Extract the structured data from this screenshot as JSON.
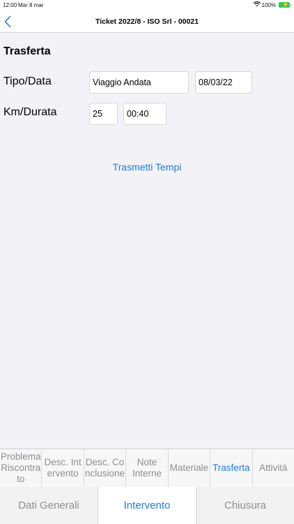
{
  "status": {
    "time": "12:00",
    "date": "Mar 8 mar",
    "battery": "100%"
  },
  "nav": {
    "title": "Ticket 2022/8 - ISO Srl - 00021"
  },
  "section": {
    "title": "Trasferta"
  },
  "form": {
    "tipo_data_label": "Tipo/Data",
    "tipo_value": "Viaggio Andata",
    "data_value": "08/03/22",
    "km_durata_label": "Km/Durata",
    "km_value": "25",
    "durata_value": "00:40"
  },
  "actions": {
    "transmit_label": "Trasmetti Tempi"
  },
  "tabs": [
    {
      "label": "Problema Riscontrato"
    },
    {
      "label": "Desc. Intervento"
    },
    {
      "label": "Desc. Conclusione"
    },
    {
      "label": "Note Interne"
    },
    {
      "label": "Materiale"
    },
    {
      "label": "Trasferta"
    },
    {
      "label": "Attività"
    }
  ],
  "bottom_tabs": [
    {
      "label": "Dati Generali"
    },
    {
      "label": "Intervento"
    },
    {
      "label": "Chiusura"
    }
  ],
  "colors": {
    "accent": "#1f7cdb",
    "inactive": "#8e8e93",
    "battery": "#34c759"
  }
}
